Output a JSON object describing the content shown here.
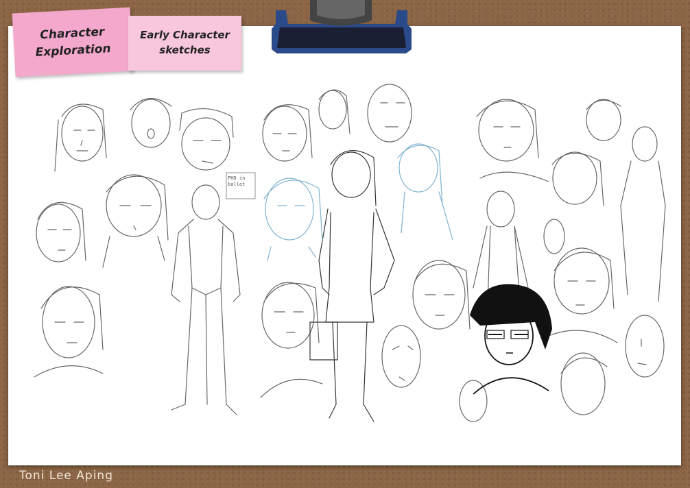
{
  "notes": {
    "primary": "Character Exploration",
    "secondary": "Early Character sketches"
  },
  "sketch_annotation": "PHD in ballet",
  "author": "Toni Lee Aping",
  "colors": {
    "cork": "#8b6545",
    "paper": "#ffffff",
    "note_primary": "#f3a8cc",
    "note_secondary": "#f8c7de",
    "clip": "#1f2440",
    "pencil": "#555555",
    "blue_pencil": "#7fb3d0",
    "ink": "#111111"
  },
  "icons": [
    "binder-clip-icon"
  ]
}
